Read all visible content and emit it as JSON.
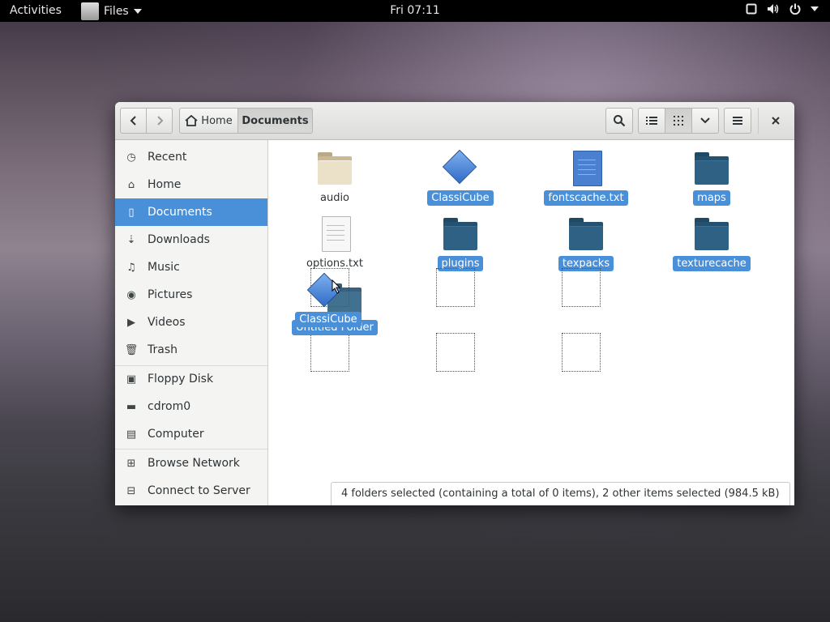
{
  "topbar": {
    "activities": "Activities",
    "app_menu": "Files",
    "clock": "Fri 07:11"
  },
  "header": {
    "breadcrumb_home": "Home",
    "breadcrumb_current": "Documents"
  },
  "sidebar": {
    "places": [
      "Recent",
      "Home",
      "Documents",
      "Downloads",
      "Music",
      "Pictures",
      "Videos",
      "Trash"
    ],
    "devices": [
      "Floppy Disk",
      "cdrom0",
      "Computer"
    ],
    "network": [
      "Browse Network",
      "Connect to Server"
    ],
    "selected": "Documents"
  },
  "files": [
    {
      "name": "audio",
      "type": "folder-beige",
      "selected": false
    },
    {
      "name": "ClassiCube",
      "type": "app",
      "selected": true
    },
    {
      "name": "fontscache.txt",
      "type": "text-blue",
      "selected": true
    },
    {
      "name": "maps",
      "type": "folder",
      "selected": true
    },
    {
      "name": "options.txt",
      "type": "text",
      "selected": false
    },
    {
      "name": "plugins",
      "type": "folder",
      "selected": true
    },
    {
      "name": "texpacks",
      "type": "folder",
      "selected": true
    },
    {
      "name": "texturecache",
      "type": "folder",
      "selected": true
    }
  ],
  "drag": {
    "dragged_label": "ClassiCube",
    "underlying_label": "Untitled Folder"
  },
  "status": "4 folders selected (containing a total of 0 items), 2 other items selected (984.5 kB)",
  "colors": {
    "selection": "#4a90d9",
    "folder": "#2b5f82",
    "folder_beige": "#d8c9a6"
  }
}
